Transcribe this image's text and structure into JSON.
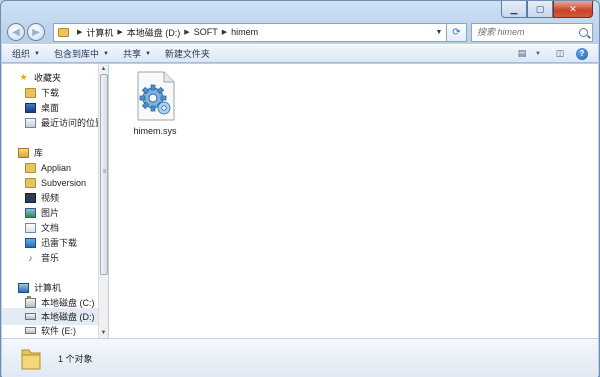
{
  "window": {
    "caption_buttons": {
      "minimize": "▁",
      "maximize": "▢",
      "close": "✕"
    }
  },
  "address_bar": {
    "crumbs": [
      "计算机",
      "本地磁盘 (D:)",
      "SOFT",
      "himem"
    ],
    "search_placeholder": "搜索 himem"
  },
  "toolbar": {
    "organize": "组织",
    "include_in_library": "包含到库中",
    "share": "共享",
    "new_folder": "新建文件夹"
  },
  "nav_pane": {
    "favorites": {
      "label": "收藏夹",
      "items": [
        "下载",
        "桌面",
        "最近访问的位置"
      ]
    },
    "libraries": {
      "label": "库",
      "items": [
        "Applian",
        "Subversion",
        "视频",
        "图片",
        "文档",
        "迅雷下载",
        "音乐"
      ]
    },
    "computer": {
      "label": "计算机",
      "items": [
        "本地磁盘 (C:)",
        "本地磁盘 (D:)",
        "软件 (E:)"
      ],
      "selected": "本地磁盘 (D:)"
    }
  },
  "content": {
    "files": [
      {
        "name": "himem.sys",
        "icon": "system-file-gear-icon"
      }
    ]
  },
  "details_pane": {
    "item_count": "1 个对象"
  }
}
